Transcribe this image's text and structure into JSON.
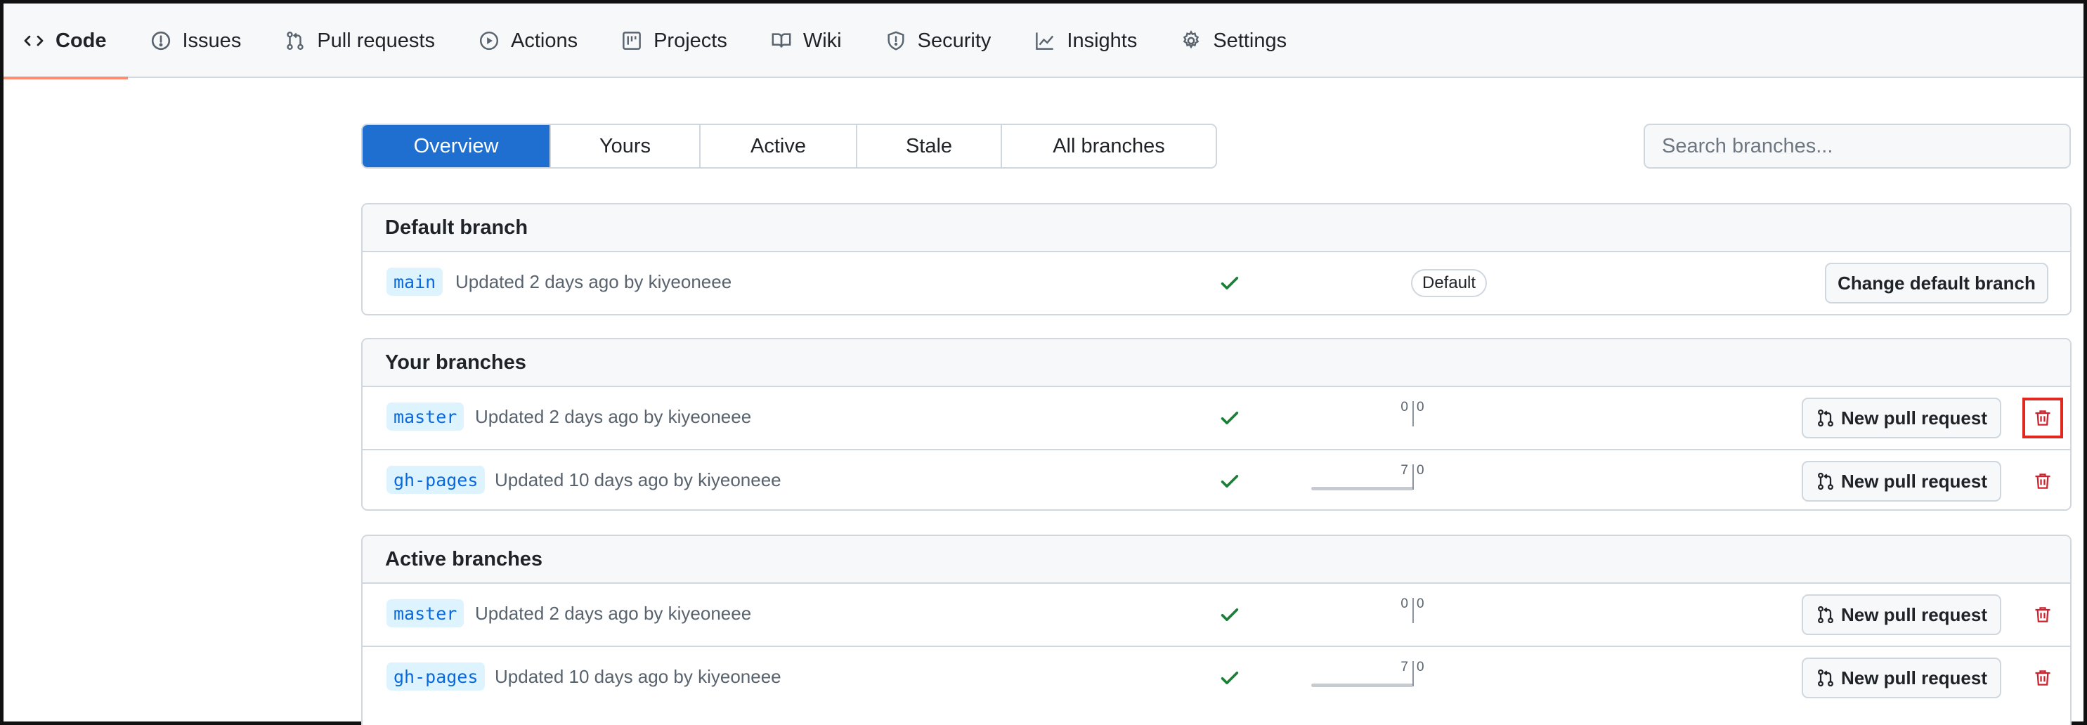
{
  "nav": {
    "tabs": [
      {
        "label": "Code",
        "icon": "code-icon",
        "selected": true
      },
      {
        "label": "Issues",
        "icon": "issue-icon"
      },
      {
        "label": "Pull requests",
        "icon": "pull-request-icon"
      },
      {
        "label": "Actions",
        "icon": "play-icon"
      },
      {
        "label": "Projects",
        "icon": "project-icon"
      },
      {
        "label": "Wiki",
        "icon": "book-icon"
      },
      {
        "label": "Security",
        "icon": "shield-icon"
      },
      {
        "label": "Insights",
        "icon": "graph-icon"
      },
      {
        "label": "Settings",
        "icon": "gear-icon"
      }
    ]
  },
  "subnav": {
    "items": [
      "Overview",
      "Yours",
      "Active",
      "Stale",
      "All branches"
    ],
    "selected": "Overview"
  },
  "search": {
    "placeholder": "Search branches..."
  },
  "default_section": {
    "title": "Default branch",
    "branch": {
      "name": "main",
      "updated": "Updated 2 days ago by kiyeoneee",
      "badge": "Default",
      "button": "Change default branch"
    }
  },
  "your_section": {
    "title": "Your branches",
    "branches": [
      {
        "name": "master",
        "updated": "Updated 2 days ago by kiyeoneee",
        "behind": "0",
        "ahead": "0",
        "button": "New pull request"
      },
      {
        "name": "gh-pages",
        "updated": "Updated 10 days ago by kiyeoneee",
        "behind": "7",
        "ahead": "0",
        "button": "New pull request"
      }
    ]
  },
  "active_section": {
    "title": "Active branches",
    "branches": [
      {
        "name": "master",
        "updated": "Updated 2 days ago by kiyeoneee",
        "behind": "0",
        "ahead": "0",
        "button": "New pull request"
      },
      {
        "name": "gh-pages",
        "updated": "Updated 10 days ago by kiyeoneee",
        "behind": "7",
        "ahead": "0",
        "button": "New pull request"
      }
    ]
  },
  "colors": {
    "accent": "#1f6fd0",
    "link": "#0969da",
    "success": "#1a7f37",
    "danger": "#cf222e",
    "tab_underline": "#fd8c73",
    "highlight": "#e0281e"
  }
}
